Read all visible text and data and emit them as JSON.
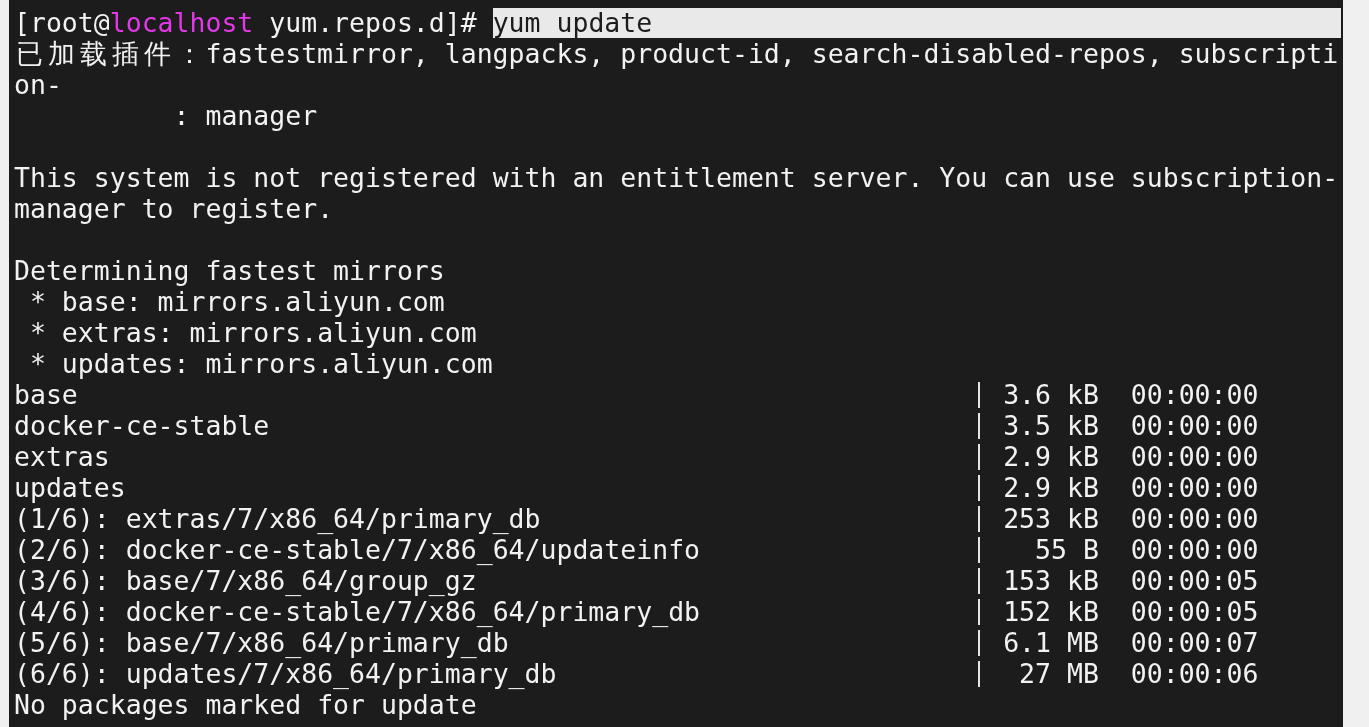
{
  "terminal": {
    "prompt": {
      "user_part": "[root@",
      "host": "localhost",
      "path_part": "yum.repos.d]#",
      "command": {
        "text": "yum update",
        "selected": true
      }
    },
    "lines": [
      {
        "kind": "text",
        "text": "已加载插件：fastestmirror, langpacks, product-id, search-disabled-repos, subscripti"
      },
      {
        "kind": "text",
        "text": "on-"
      },
      {
        "kind": "text",
        "text": "          : manager"
      },
      {
        "kind": "blank"
      },
      {
        "kind": "text",
        "text": "This system is not registered with an entitlement server. You can use subscription-"
      },
      {
        "kind": "text",
        "text": "manager to register."
      },
      {
        "kind": "blank"
      },
      {
        "kind": "text",
        "text": "Determining fastest mirrors"
      },
      {
        "kind": "text",
        "text": " * base: mirrors.aliyun.com"
      },
      {
        "kind": "text",
        "text": " * extras: mirrors.aliyun.com"
      },
      {
        "kind": "text",
        "text": " * updates: mirrors.aliyun.com"
      },
      {
        "kind": "transfer",
        "name": "base",
        "size": "3.6 kB",
        "time": "00:00:00"
      },
      {
        "kind": "transfer",
        "name": "docker-ce-stable",
        "size": "3.5 kB",
        "time": "00:00:00"
      },
      {
        "kind": "transfer",
        "name": "extras",
        "size": "2.9 kB",
        "time": "00:00:00"
      },
      {
        "kind": "transfer",
        "name": "updates",
        "size": "2.9 kB",
        "time": "00:00:00"
      },
      {
        "kind": "transfer",
        "name": "(1/6): extras/7/x86_64/primary_db",
        "size": "253 kB",
        "time": "00:00:00"
      },
      {
        "kind": "transfer",
        "name": "(2/6): docker-ce-stable/7/x86_64/updateinfo",
        "size": "55 B",
        "time": "00:00:00"
      },
      {
        "kind": "transfer",
        "name": "(3/6): base/7/x86_64/group_gz",
        "size": "153 kB",
        "time": "00:00:05"
      },
      {
        "kind": "transfer",
        "name": "(4/6): docker-ce-stable/7/x86_64/primary_db",
        "size": "152 kB",
        "time": "00:00:05"
      },
      {
        "kind": "transfer",
        "name": "(5/6): base/7/x86_64/primary_db",
        "size": "6.1 MB",
        "time": "00:00:07"
      },
      {
        "kind": "transfer",
        "name": "(6/6): updates/7/x86_64/primary_db",
        "size": "27 MB",
        "time": "00:00:06"
      },
      {
        "kind": "text",
        "text": "No packages marked for update"
      }
    ]
  }
}
